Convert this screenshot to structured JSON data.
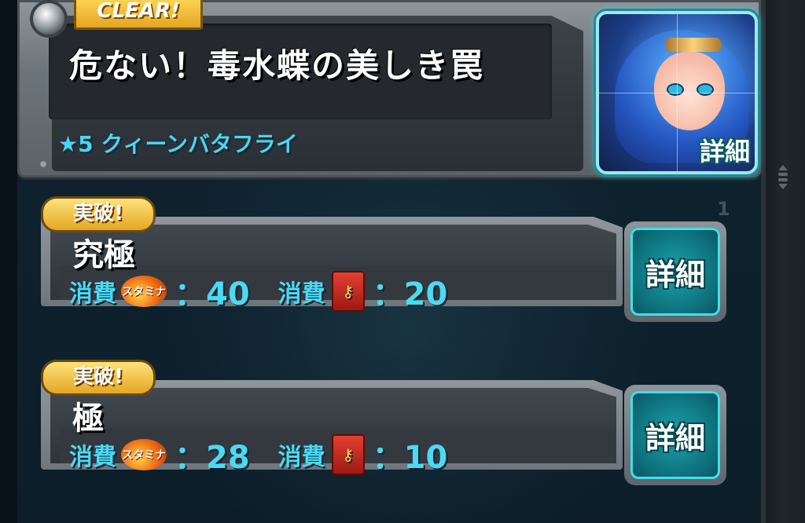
{
  "header": {
    "clear_badge": "CLEAR!",
    "quest_title": "危ない！毒水蝶の美しき罠",
    "boss_name": "★5 クィーンバタフライ",
    "portrait_detail": "詳細"
  },
  "list": {
    "page_indicator": "1",
    "rows": [
      {
        "badge": "実破!",
        "difficulty": "究極",
        "consume_label": "消費",
        "stamina_icon_text": "スタミナ",
        "stamina_cost": "：40",
        "consume_label_2": "消費",
        "book_cost": "：20",
        "detail": "詳細"
      },
      {
        "badge": "実破!",
        "difficulty": "極",
        "consume_label": "消費",
        "stamina_icon_text": "スタミナ",
        "stamina_cost": "：28",
        "consume_label_2": "消費",
        "book_cost": "：10",
        "detail": "詳細"
      }
    ]
  },
  "icons": {
    "stamina": "stamina-flame-icon",
    "book": "key-book-icon",
    "pin": "pin-icon",
    "scroll": "scroll-handle-icon"
  },
  "colors": {
    "accent_cyan": "#48d6f2",
    "badge_gold": "#e4a520",
    "detail_teal": "#0d6d78"
  }
}
